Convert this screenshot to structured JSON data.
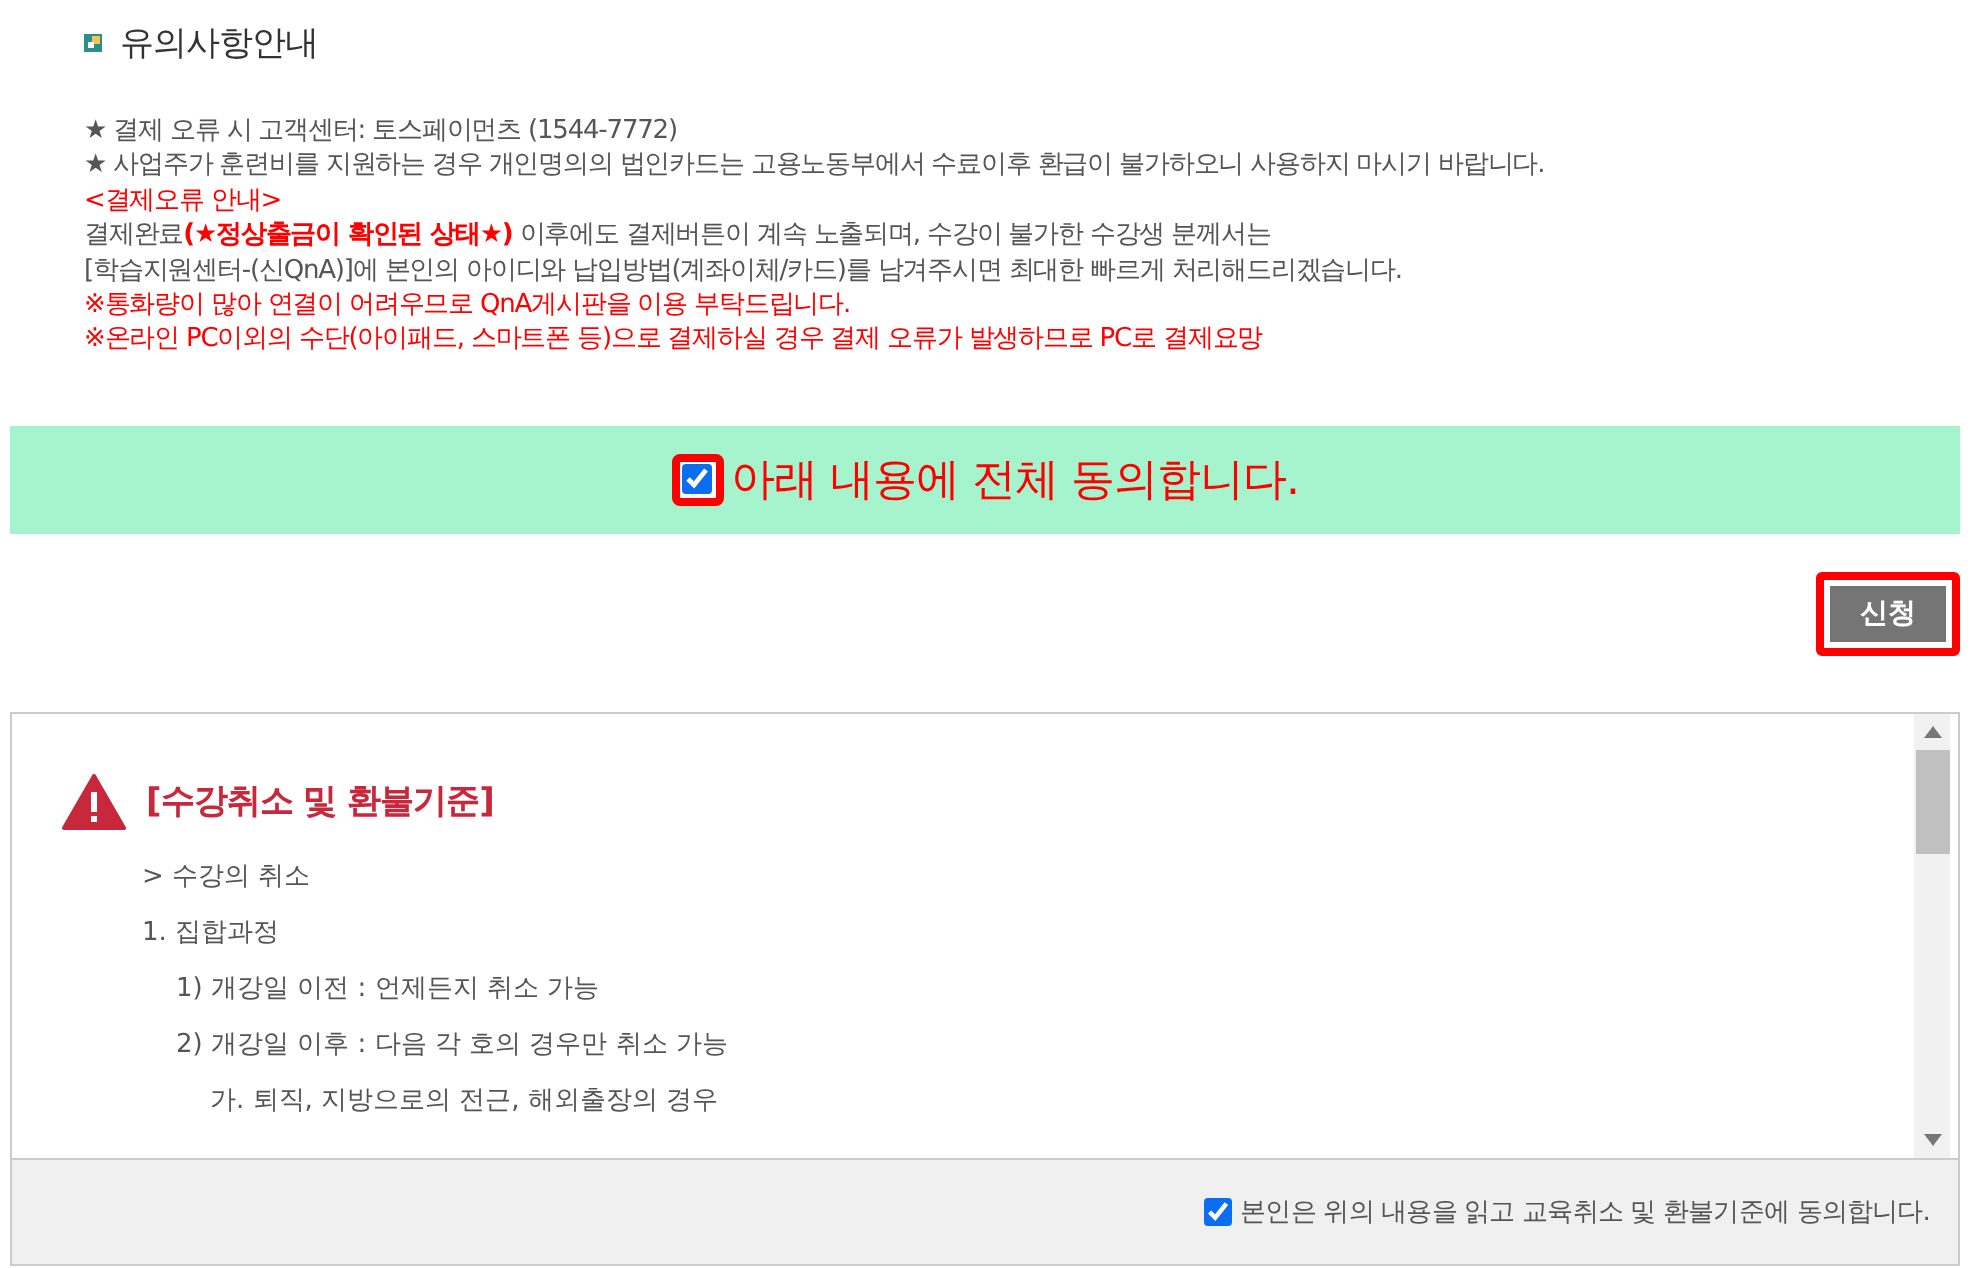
{
  "section_title": "유의사항안내",
  "notices": [
    {
      "kind": "plain",
      "text": "★ 결제 오류 시 고객센터: 토스페이먼츠 (1544-7772)"
    },
    {
      "kind": "plain",
      "text": "★ 사업주가 훈련비를 지원하는 경우 개인명의의 법인카드는 고용노동부에서 수료이후 환급이 불가하오니 사용하지 마시기 바랍니다."
    },
    {
      "kind": "alert",
      "text": "<결제오류 안내>"
    },
    {
      "kind": "plain",
      "text": "결제완료**(★정상출금이 확인된 상태★)** 이후에도 결제버튼이 계속 노출되며, 수강이 불가한 수강생 분께서는"
    },
    {
      "kind": "plain",
      "text": "[학습지원센터-(신QnA)]에 본인의 아이디와 납입방법(계좌이체/카드)를 남겨주시면 최대한 빠르게 처리해드리겠습니다."
    },
    {
      "kind": "alert",
      "text": "※통화량이 많아 연결이 어려우므로 QnA게시판을 이용 부탁드립니다."
    },
    {
      "kind": "alert",
      "text": "※온라인 PC이외의 수단(아이패드, 스마트폰 등)으로 결제하실 경우 결제 오류가 발생하므로 PC로 결제요망"
    }
  ],
  "agree_all": {
    "label": "아래 내용에 전체 동의합니다.",
    "checked": true
  },
  "apply_button": "신청",
  "policy": {
    "title": "[수강취소 및 환불기준]",
    "lines": [
      {
        "text": "> 수강의 취소"
      },
      {
        "text": "1. 집합과정",
        "children": [
          {
            "text": "1) 개강일 이전 : 언제든지 취소 가능"
          },
          {
            "text": "2) 개강일 이후 : 다음 각 호의 경우만 취소 가능",
            "children": [
              {
                "text": "가. 퇴직, 지방으로의 전근, 해외출장의 경우"
              }
            ]
          }
        ]
      }
    ],
    "consent": {
      "label": "본인은 위의 내용을 읽고 교육취소 및 환불기준에 동의합니다.",
      "checked": true
    }
  }
}
